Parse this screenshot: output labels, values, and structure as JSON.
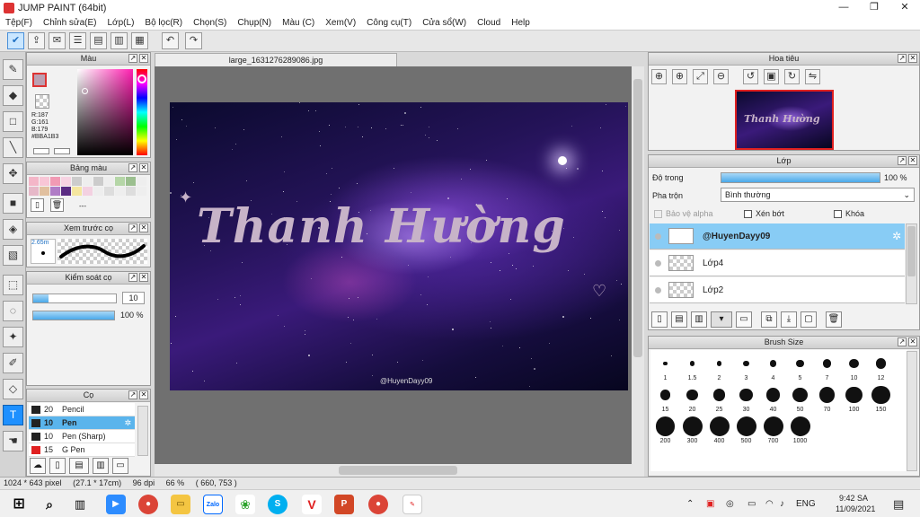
{
  "window": {
    "title": "JUMP PAINT (64bit)",
    "controls": [
      "—",
      "❐",
      "✕"
    ]
  },
  "menu": [
    "Tệp(F)",
    "Chỉnh sửa(E)",
    "Lớp(L)",
    "Bộ lọc(R)",
    "Chọn(S)",
    "Chụp(N)",
    "Màu (C)",
    "Xem(V)",
    "Công cụ(T)",
    "Cửa sổ(W)",
    "Cloud",
    "Help"
  ],
  "document": {
    "tab": "large_1631276289086.jpg",
    "art_text": "Thanh Hường",
    "art_handle": "@HuyenDayy09"
  },
  "color_panel": {
    "title": "Màu",
    "r": "R:187",
    "g": "G:161",
    "b": "B:179",
    "hex": "#BBA1B3",
    "accent": "#BBA1B3"
  },
  "swatch_panel": {
    "title": "Bảng màu",
    "extra": "---"
  },
  "preview_panel": {
    "title": "Xem trước cọ",
    "size": "2.65m"
  },
  "control_panel": {
    "title": "Kiểm soát cọ",
    "size_value": "10",
    "opacity_value": "100 %"
  },
  "brush_panel": {
    "title": "Cọ",
    "items": [
      {
        "size": "20",
        "name": "Pencil",
        "color": "#222222"
      },
      {
        "size": "10",
        "name": "Pen",
        "color": "#222222"
      },
      {
        "size": "10",
        "name": "Pen (Sharp)",
        "color": "#222222"
      },
      {
        "size": "15",
        "name": "G Pen",
        "color": "#e02020"
      }
    ]
  },
  "navigator": {
    "title": "Hoa tiêu"
  },
  "layers": {
    "title": "Lớp",
    "opacity_label": "Độ trong",
    "opacity_value": "100 %",
    "opacity_fraction": 1.0,
    "blend_label": "Pha trộn",
    "blend_value": "Bình thường",
    "protect_alpha": "Bảo vệ alpha",
    "clip": "Xén bớt",
    "lock": "Khóa",
    "items": [
      "@HuyenDayy09",
      "Lớp4",
      "Lớp2"
    ]
  },
  "brush_size": {
    "title": "Brush Size",
    "sizes": [
      "1",
      "1.5",
      "2",
      "3",
      "4",
      "5",
      "7",
      "10",
      "12",
      "15",
      "20",
      "25",
      "30",
      "40",
      "50",
      "70",
      "100",
      "150",
      "200",
      "300",
      "400",
      "500",
      "700",
      "1000"
    ]
  },
  "status": {
    "dims": "1024 * 643 pixel",
    "phys": "(27.1 * 17cm)",
    "dpi": "96 dpi",
    "zoom": "66 %",
    "coords": "( 660, 753 )"
  },
  "taskbar": {
    "lang": "ENG",
    "time": "9:42 SA",
    "date": "11/09/2021",
    "zalo": "Zalo"
  }
}
